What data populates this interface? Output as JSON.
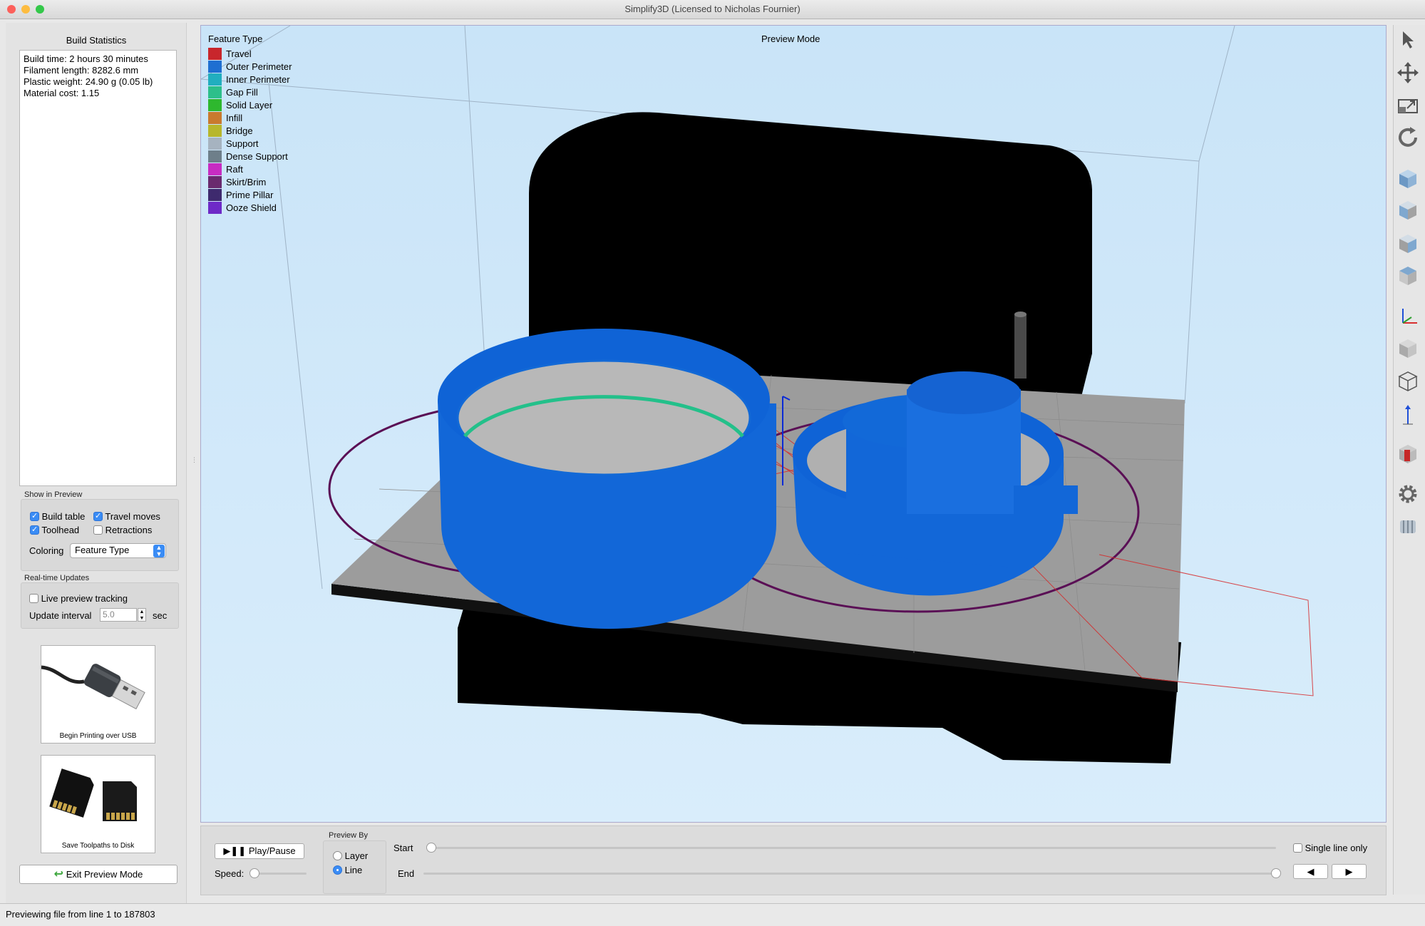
{
  "window": {
    "title": "Simplify3D (Licensed to Nicholas Fournier)"
  },
  "colors": {
    "accent": "#3a8cf5",
    "model_blue": "#1469d8",
    "travel_red": "#d32f2f",
    "viewport_bg": "#c9e4f8",
    "build_plate": "#9a9a9a"
  },
  "build_statistics": {
    "title": "Build Statistics",
    "lines": [
      "Build time: 2 hours 30 minutes",
      "Filament length: 8282.6 mm",
      "Plastic weight: 24.90 g (0.05 lb)",
      "Material cost: 1.15"
    ]
  },
  "show_in_preview": {
    "label": "Show in Preview",
    "build_table": {
      "label": "Build table",
      "checked": true
    },
    "travel_moves": {
      "label": "Travel moves",
      "checked": true
    },
    "toolhead": {
      "label": "Toolhead",
      "checked": true
    },
    "retractions": {
      "label": "Retractions",
      "checked": false
    },
    "coloring_label": "Coloring",
    "coloring_value": "Feature Type"
  },
  "realtime_updates": {
    "label": "Real-time Updates",
    "live_preview": {
      "label": "Live preview tracking",
      "checked": false
    },
    "interval_label": "Update interval",
    "interval_value": "5.0",
    "interval_unit": "sec"
  },
  "actions": {
    "usb_label": "Begin Printing over USB",
    "sd_label": "Save Toolpaths to Disk",
    "exit_label": "Exit Preview Mode"
  },
  "viewport": {
    "mode_label": "Preview Mode",
    "legend_title": "Feature Type",
    "legend": [
      {
        "label": "Travel",
        "color": "#c8262c"
      },
      {
        "label": "Outer Perimeter",
        "color": "#1f6fd1"
      },
      {
        "label": "Inner Perimeter",
        "color": "#21aebf"
      },
      {
        "label": "Gap Fill",
        "color": "#2dbf8a"
      },
      {
        "label": "Solid Layer",
        "color": "#2eb82e"
      },
      {
        "label": "Infill",
        "color": "#c97a2e"
      },
      {
        "label": "Bridge",
        "color": "#b7b72c"
      },
      {
        "label": "Support",
        "color": "#a6b3c0"
      },
      {
        "label": "Dense Support",
        "color": "#6e7f8a"
      },
      {
        "label": "Raft",
        "color": "#c72cc2"
      },
      {
        "label": "Skirt/Brim",
        "color": "#6a2a6e"
      },
      {
        "label": "Prime Pillar",
        "color": "#3e2a6e"
      },
      {
        "label": "Ooze Shield",
        "color": "#6e2ac7"
      }
    ]
  },
  "right_toolbar": {
    "tools": [
      "select-arrow-icon",
      "move-icon",
      "scale-icon",
      "rotate-icon",
      "cube-view-1-icon",
      "cube-view-2-icon",
      "cube-view-3-icon",
      "cube-view-4-icon",
      "axes-icon",
      "solid-cube-icon",
      "wireframe-cube-icon",
      "z-axis-icon",
      "cross-section-icon",
      "settings-gear-icon",
      "filament-icon"
    ]
  },
  "controls": {
    "play_pause_label": "Play/Pause",
    "speed_label": "Speed:",
    "preview_by_label": "Preview By",
    "layer_label": "Layer",
    "line_label": "Line",
    "preview_by_selected": "Line",
    "start_label": "Start",
    "end_label": "End",
    "single_line_label": "Single line only",
    "single_line_checked": false,
    "start_position": 0.0,
    "end_position": 1.0,
    "speed_position": 0.0
  },
  "status": {
    "text": "Previewing file from line 1 to 187803"
  }
}
